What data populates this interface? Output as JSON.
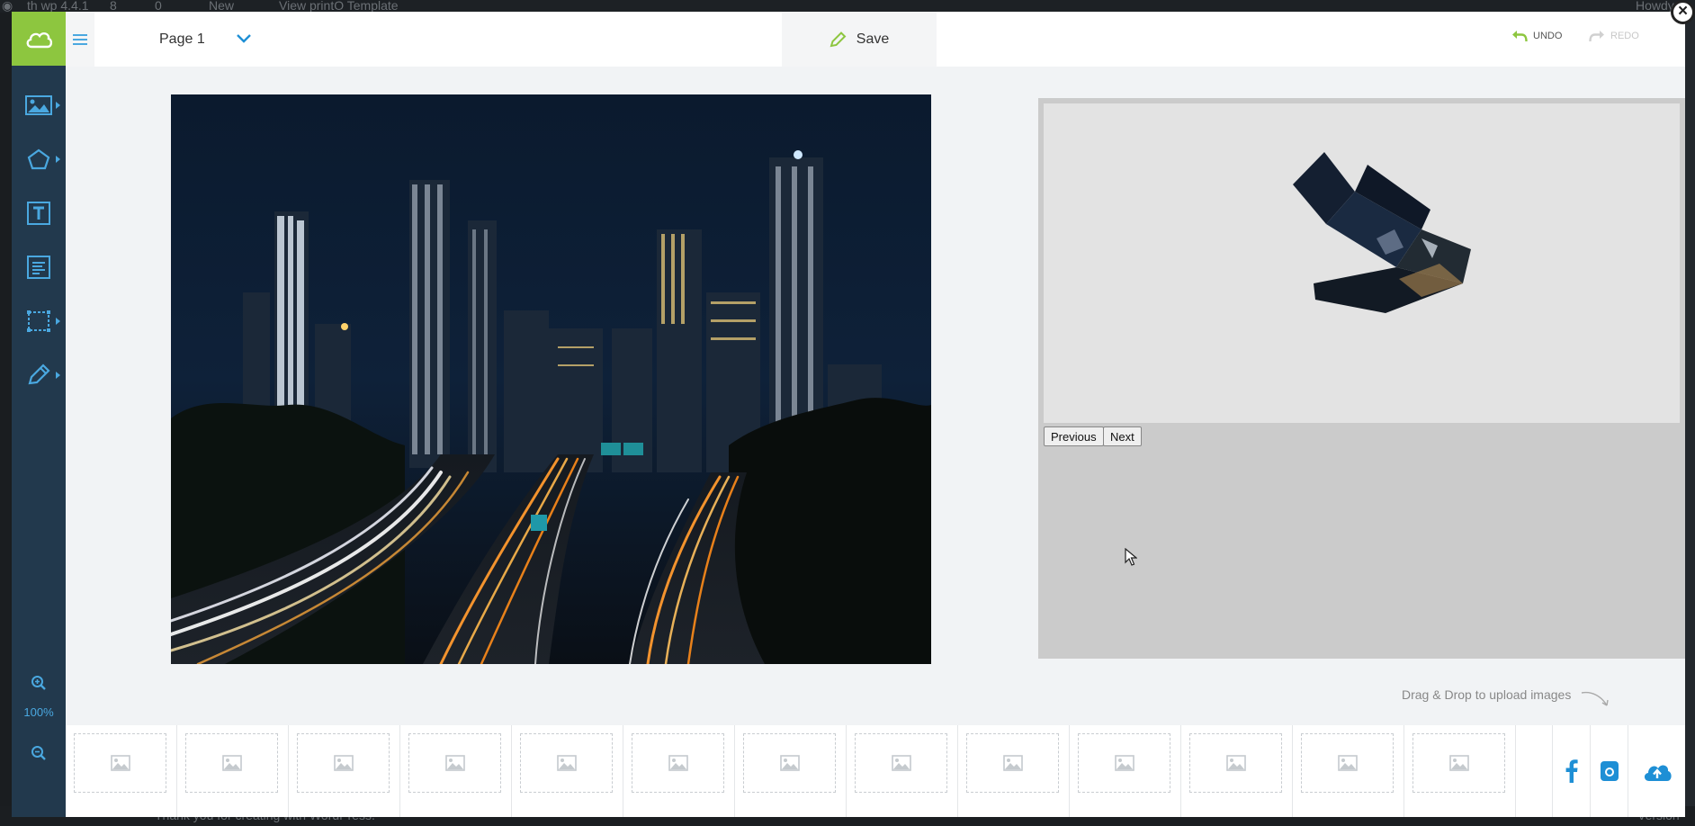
{
  "wp_admin_bar": {
    "site_name": "th wp 4.4.1",
    "updates_count": "8",
    "comments_count": "0",
    "new_label": "New",
    "view_template_label": "View printO Template",
    "howdy_label": "Howdy"
  },
  "wp_footer": {
    "thanks_text": "Thank you for creating with WordPress.",
    "version_text": "Version"
  },
  "header": {
    "page_name": "Page 1",
    "save_label": "Save",
    "undo_label": "UNDO",
    "redo_label": "REDO"
  },
  "toolbar": {
    "zoom_level": "100%",
    "tools": [
      "image-tool",
      "shape-tool",
      "text-tool",
      "paragraph-tool",
      "frame-tool",
      "draw-tool"
    ]
  },
  "preview": {
    "previous_label": "Previous",
    "next_label": "Next"
  },
  "bottom": {
    "drag_drop_text": "Drag & Drop to upload images",
    "thumbnail_slot_count": 13,
    "upload_sources": [
      "facebook",
      "instagram",
      "upload-cloud"
    ]
  },
  "colors": {
    "brand_green": "#8dc63f",
    "toolbar_navy": "#22394d",
    "accent_blue": "#4aa8e0"
  }
}
